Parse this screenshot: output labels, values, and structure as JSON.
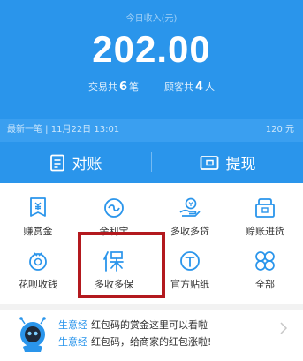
{
  "header": {
    "today_label": "今日收入(元)",
    "amount": "202.00",
    "stats": {
      "trade_prefix": "交易共",
      "trade_count": "6",
      "trade_unit": "笔",
      "customer_prefix": "顾客共",
      "customer_count": "4",
      "customer_unit": "人"
    },
    "latest": {
      "left": "最新一笔 | 11月22日 13:01",
      "right": "120 元"
    },
    "buttons": {
      "reconcile": "对账",
      "withdraw": "提现"
    }
  },
  "grid": {
    "items": [
      {
        "label": "赚赏金",
        "icon": "reward-icon"
      },
      {
        "label": "余利宝",
        "icon": "yulibao-icon"
      },
      {
        "label": "多收多贷",
        "icon": "loan-icon"
      },
      {
        "label": "赊账进货",
        "icon": "credit-purchase-icon"
      },
      {
        "label": "花呗收钱",
        "icon": "huabei-icon"
      },
      {
        "label": "多收多保",
        "icon": "insurance-icon"
      },
      {
        "label": "官方贴纸",
        "icon": "sticker-icon"
      },
      {
        "label": "全部",
        "icon": "all-icon"
      }
    ]
  },
  "news": {
    "lines": [
      {
        "tag": "生意经",
        "text": "红包码的赏金这里可以看啦"
      },
      {
        "tag": "生意经",
        "text": "红包码，给商家的红包涨啦!"
      }
    ]
  },
  "colors": {
    "brand_blue": "#2a95eb",
    "highlight_red": "#b3191e"
  }
}
